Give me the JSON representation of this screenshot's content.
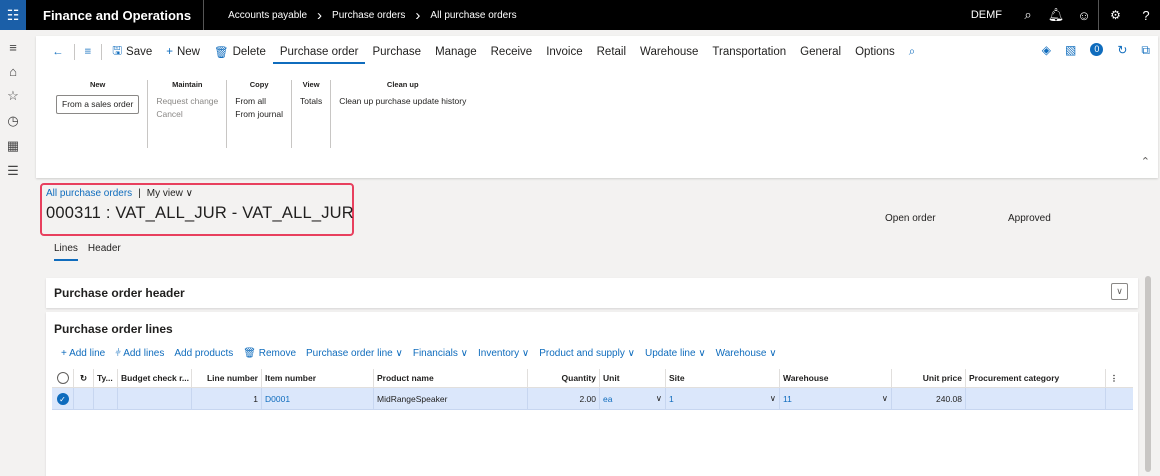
{
  "topbar": {
    "app_name": "Finance and Operations",
    "breadcrumb": [
      "Accounts payable",
      "Purchase orders",
      "All purchase orders"
    ],
    "company": "DEMF"
  },
  "commands": {
    "save": "Save",
    "new": "New",
    "delete": "Delete",
    "tabs": [
      "Purchase order",
      "Purchase",
      "Manage",
      "Receive",
      "Invoice",
      "Retail",
      "Warehouse",
      "Transportation",
      "General",
      "Options"
    ],
    "badge_count": "0"
  },
  "ribbon": {
    "new": {
      "header": "New",
      "items": [
        "From a sales order"
      ]
    },
    "maintain": {
      "header": "Maintain",
      "items": [
        "Request change",
        "Cancel"
      ]
    },
    "copy": {
      "header": "Copy",
      "items": [
        "From all",
        "From journal"
      ]
    },
    "view": {
      "header": "View",
      "items": [
        "Totals"
      ]
    },
    "cleanup": {
      "header": "Clean up",
      "items": [
        "Clean up purchase update history"
      ]
    }
  },
  "header": {
    "breadcrumb_link": "All purchase orders",
    "view_name": "My view",
    "title": "000311 : VAT_ALL_JUR - VAT_ALL_JUR",
    "status_open": "Open order",
    "status_approved": "Approved",
    "tab_lines": "Lines",
    "tab_header": "Header"
  },
  "sections": {
    "po_header": "Purchase order header",
    "po_lines": "Purchase order lines"
  },
  "line_actions": [
    "+ Add line",
    "Add lines",
    "Add products",
    "Remove",
    "Purchase order line",
    "Financials",
    "Inventory",
    "Product and supply",
    "Update line",
    "Warehouse"
  ],
  "grid": {
    "columns": [
      "Ty...",
      "Budget check r...",
      "Line number",
      "Item number",
      "Product name",
      "Quantity",
      "Unit",
      "Site",
      "Warehouse",
      "Unit price",
      "Procurement category"
    ],
    "rows": [
      {
        "line_number": "1",
        "item_number": "D0001",
        "product_name": "MidRangeSpeaker",
        "quantity": "2.00",
        "unit": "ea",
        "site": "1",
        "warehouse": "11",
        "unit_price": "240.08",
        "procurement_category": ""
      }
    ]
  }
}
